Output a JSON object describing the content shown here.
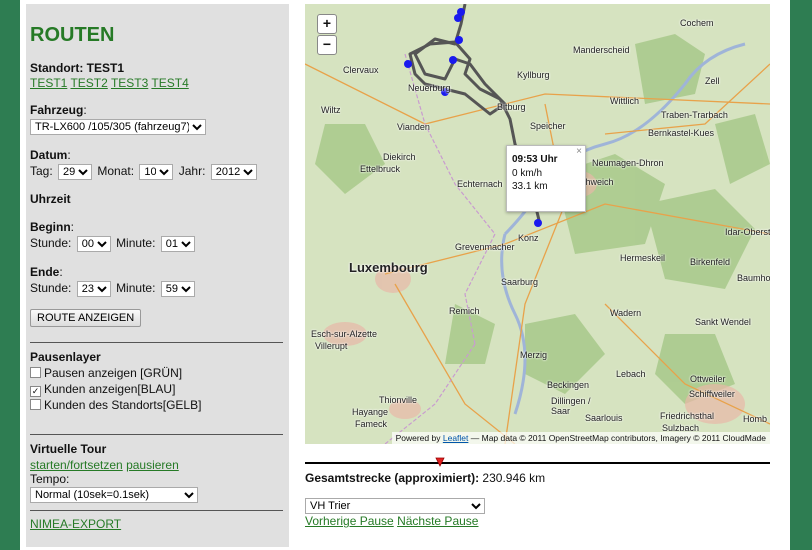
{
  "sidebar": {
    "title": "ROUTEN",
    "standort_label": "Standort: TEST1",
    "standort_links": [
      "TEST1",
      "TEST2",
      "TEST3",
      "TEST4"
    ],
    "fahrzeug_label": "Fahrzeug",
    "fahrzeug_value": "TR-LX600 /105/305 (fahrzeug7)",
    "datum_label": "Datum",
    "tag_label": "Tag:",
    "tag_value": "29",
    "monat_label": "Monat:",
    "monat_value": "10",
    "jahr_label": "Jahr:",
    "jahr_value": "2012",
    "uhrzeit_label": "Uhrzeit",
    "beginn_label": "Beginn",
    "beginn_stunde_label": "Stunde:",
    "beginn_stunde_value": "00",
    "beginn_minute_label": "Minute:",
    "beginn_minute_value": "01",
    "ende_label": "Ende",
    "ende_stunde_label": "Stunde:",
    "ende_stunde_value": "23",
    "ende_minute_label": "Minute:",
    "ende_minute_value": "59",
    "route_button": "ROUTE ANZEIGEN",
    "pausenlayer_label": "Pausenlayer",
    "layers": [
      {
        "label": "Pausen anzeigen [GRÜN]",
        "checked": false
      },
      {
        "label": "Kunden anzeigen[BLAU]",
        "checked": true
      },
      {
        "label": "Kunden des Standorts[GELB]",
        "checked": false
      }
    ],
    "tour_label": "Virtuelle Tour",
    "tour_start": "starten/fortsetzen",
    "tour_pause": "pausieren",
    "tempo_label": "Tempo:",
    "tempo_value": "Normal (10sek=0.1sek)",
    "export_link": "NIMEA-EXPORT"
  },
  "map": {
    "zoom_in": "+",
    "zoom_out": "−",
    "places": [
      "Cochem",
      "Manderscheid",
      "Clervaux",
      "Kyllburg",
      "Zell",
      "Wittlich",
      "Traben-Trarbach",
      "Wiltz",
      "Neuerburg",
      "Bitburg",
      "Bernkastel-Kues",
      "Vianden",
      "Speicher",
      "Diekirch",
      "Ettelbruck",
      "Neumagen-Dhron",
      "Echternach",
      "Schweich",
      "Idar-Oberst",
      "Grevenmacher",
      "Konz",
      "Luxembourg",
      "Hermeskeil",
      "Birkenfeld",
      "Baumho",
      "Saarburg",
      "Esch-sur-Alzette",
      "Remich",
      "Wadern",
      "Villerupt",
      "Sankt Wendel",
      "Merzig",
      "Lebach",
      "Ottweiler",
      "Beckingen",
      "Schiffweiler",
      "Thionville",
      "Dillingen / Saar",
      "Saarlouis",
      "Hayange",
      "Friedrichsthal",
      "Fameck",
      "Sulzbach",
      "Homb"
    ],
    "popup": {
      "time": "09:53 Uhr",
      "speed": "0 km/h",
      "distance": "33.1 km",
      "close": "×"
    },
    "attribution_prefix": "Powered by",
    "attribution_link": "Leaflet",
    "attribution_suffix": "— Map data © 2011 OpenStreetMap contributors, Imagery © 2011 CloudMade"
  },
  "bottom": {
    "progress": 0.29,
    "gesamt_label": "Gesamtstrecke (approximiert):",
    "gesamt_value": "230.946 km",
    "pause_select": "VH Trier",
    "prev_pause": "Vorherige Pause",
    "next_pause": "Nächste Pause"
  }
}
